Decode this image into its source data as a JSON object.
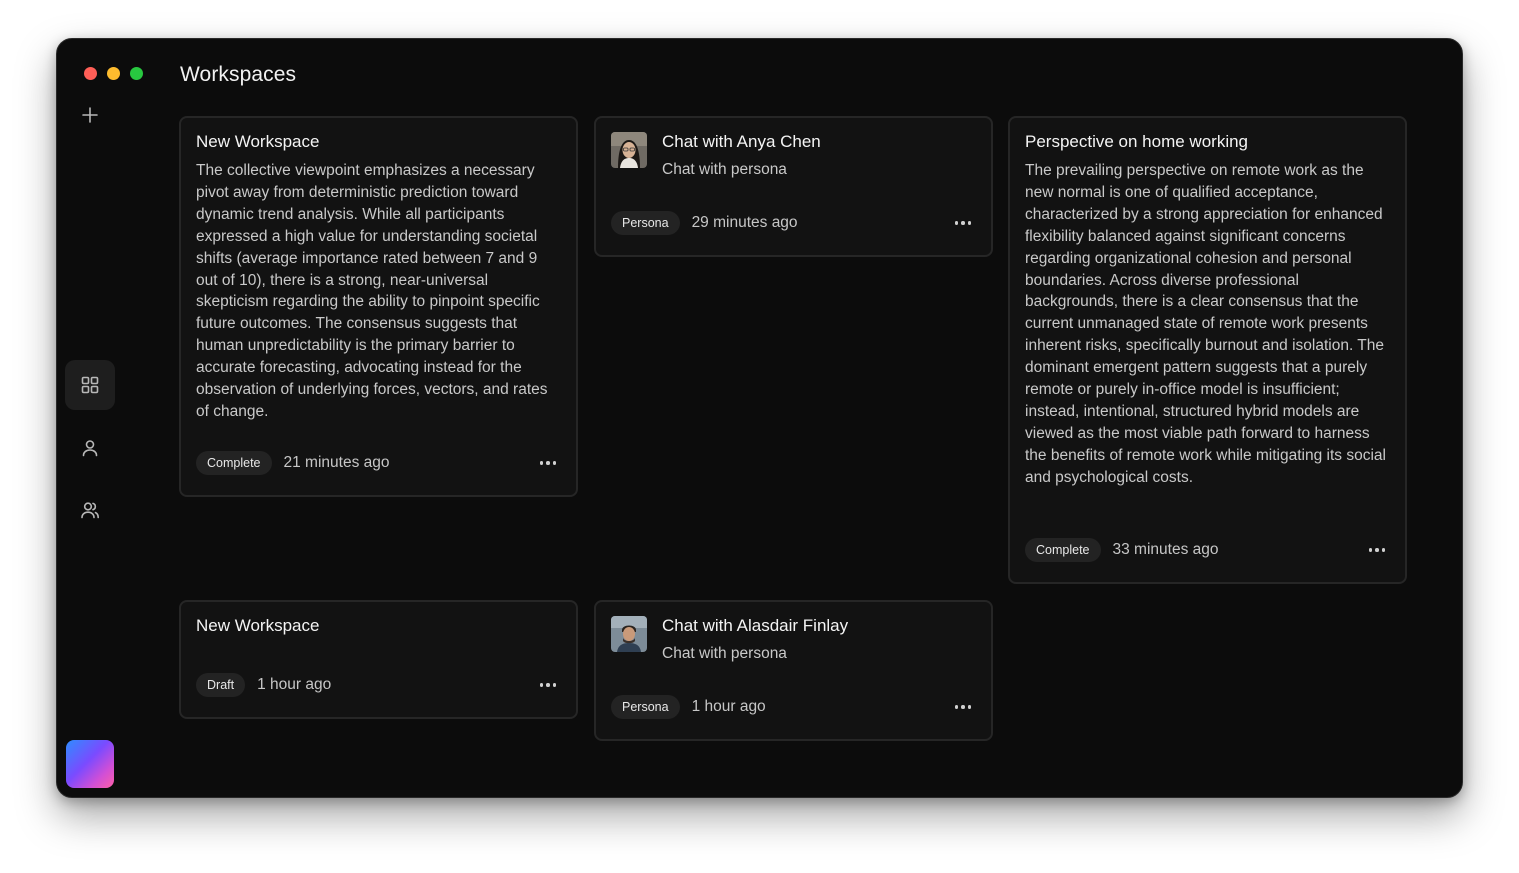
{
  "window": {
    "title": "Workspaces"
  },
  "sidebar": {
    "items": [
      {
        "name": "new",
        "icon": "plus-icon"
      },
      {
        "name": "workspaces",
        "icon": "grid-icon",
        "active": true
      },
      {
        "name": "persona",
        "icon": "person-icon"
      },
      {
        "name": "group",
        "icon": "users-icon"
      }
    ]
  },
  "workspaces": [
    {
      "title": "New Workspace",
      "body": "The collective viewpoint emphasizes a necessary pivot away from deterministic prediction toward dynamic trend analysis. While all participants expressed a high value for understanding societal shifts (average importance rated between 7 and 9 out of 10), there is a strong, near-universal skepticism regarding the ability to pinpoint specific future outcomes. The consensus suggests that human unpredictability is the primary barrier to accurate forecasting, advocating instead for the observation of underlying forces, vectors, and rates of change.",
      "status": "Complete",
      "time": "21 minutes ago"
    },
    {
      "title": "Chat with Anya Chen",
      "subtitle": "Chat with persona",
      "status": "Persona",
      "time": "29 minutes ago"
    },
    {
      "title": "Perspective on home working",
      "body": "The prevailing perspective on remote work as the new normal is one of qualified acceptance, characterized by a strong appreciation for enhanced flexibility balanced against significant concerns regarding organizational cohesion and personal boundaries. Across diverse professional backgrounds, there is a clear consensus that the current unmanaged state of remote work presents inherent risks, specifically burnout and isolation. The dominant emergent pattern suggests that a purely remote or purely in-office model is insufficient; instead, intentional, structured hybrid models are viewed as the most viable path forward to harness the benefits of remote work while mitigating its social and psychological costs.",
      "status": "Complete",
      "time": "33 minutes ago"
    },
    {
      "title": "New Workspace",
      "status": "Draft",
      "time": "1 hour ago"
    },
    {
      "title": "Chat with Alasdair Finlay",
      "subtitle": "Chat with persona",
      "status": "Persona",
      "time": "1 hour ago"
    }
  ]
}
